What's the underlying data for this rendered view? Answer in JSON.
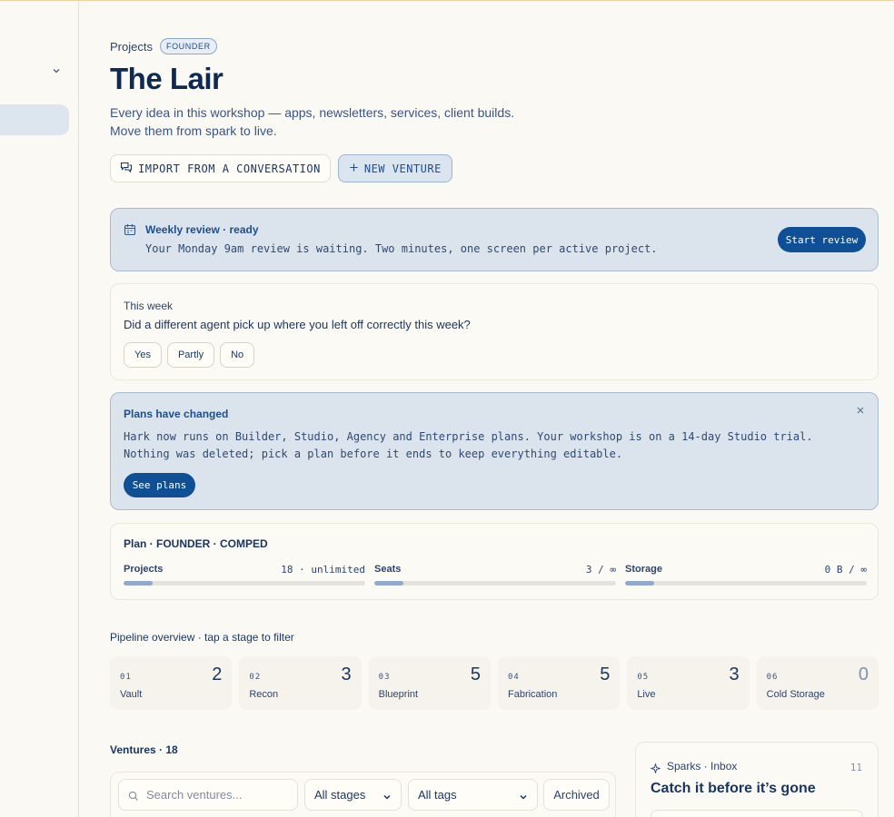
{
  "breadcrumb": {
    "projects": "Projects",
    "badge": "FOUNDER"
  },
  "page": {
    "title": "The Lair",
    "description": "Every idea in this workshop — apps, newsletters, services, client builds. Move them from spark to live."
  },
  "actions": {
    "import_label": "IMPORT FROM A CONVERSATION",
    "new_label": "NEW VENTURE"
  },
  "review": {
    "title": "Weekly review · ready",
    "desc": "Your Monday 9am review is waiting. Two minutes, one screen per active project.",
    "button": "Start review"
  },
  "week": {
    "label": "This week",
    "question": "Did a different agent pick up where you left off correctly this week?",
    "options": [
      "Yes",
      "Partly",
      "No"
    ]
  },
  "plans": {
    "title": "Plans have changed",
    "desc": "Hark now runs on Builder, Studio, Agency and Enterprise plans. Your workshop is on a 14-day Studio trial. Nothing was deleted; pick a plan before it ends to keep everything editable.",
    "button": "See plans"
  },
  "plan": {
    "title": "Plan · FOUNDER · COMPED",
    "meters": [
      {
        "name": "Projects",
        "value": "18 · unlimited",
        "fill": 0.12
      },
      {
        "name": "Seats",
        "value": "3 / ∞",
        "fill": 0.12
      },
      {
        "name": "Storage",
        "value": "0 B / ∞",
        "fill": 0.12
      }
    ]
  },
  "pipeline": {
    "label": "Pipeline overview · tap a stage to filter",
    "stages": [
      {
        "num": "01",
        "name": "Vault",
        "count": "2"
      },
      {
        "num": "02",
        "name": "Recon",
        "count": "3"
      },
      {
        "num": "03",
        "name": "Blueprint",
        "count": "5"
      },
      {
        "num": "04",
        "name": "Fabrication",
        "count": "5"
      },
      {
        "num": "05",
        "name": "Live",
        "count": "3"
      },
      {
        "num": "06",
        "name": "Cold Storage",
        "count": "0"
      }
    ]
  },
  "ventures": {
    "label": "Ventures · 18",
    "search_placeholder": "Search ventures...",
    "stage_filter": "All stages",
    "tag_filter": "All tags",
    "archived": "Archived"
  },
  "sparks": {
    "label": "Sparks · Inbox",
    "count": "11",
    "title": "Catch it before it’s gone"
  },
  "colors": {
    "accent": "#0f4f96",
    "ink": "#17355f",
    "banner_bg": "#dbe4ec",
    "page_bg": "#fbf9f4"
  },
  "icons": [
    "chevron-down-icon",
    "chat-bubbles-icon",
    "plus-icon",
    "calendar-icon",
    "close-icon",
    "search-icon",
    "sparkle-icon"
  ]
}
